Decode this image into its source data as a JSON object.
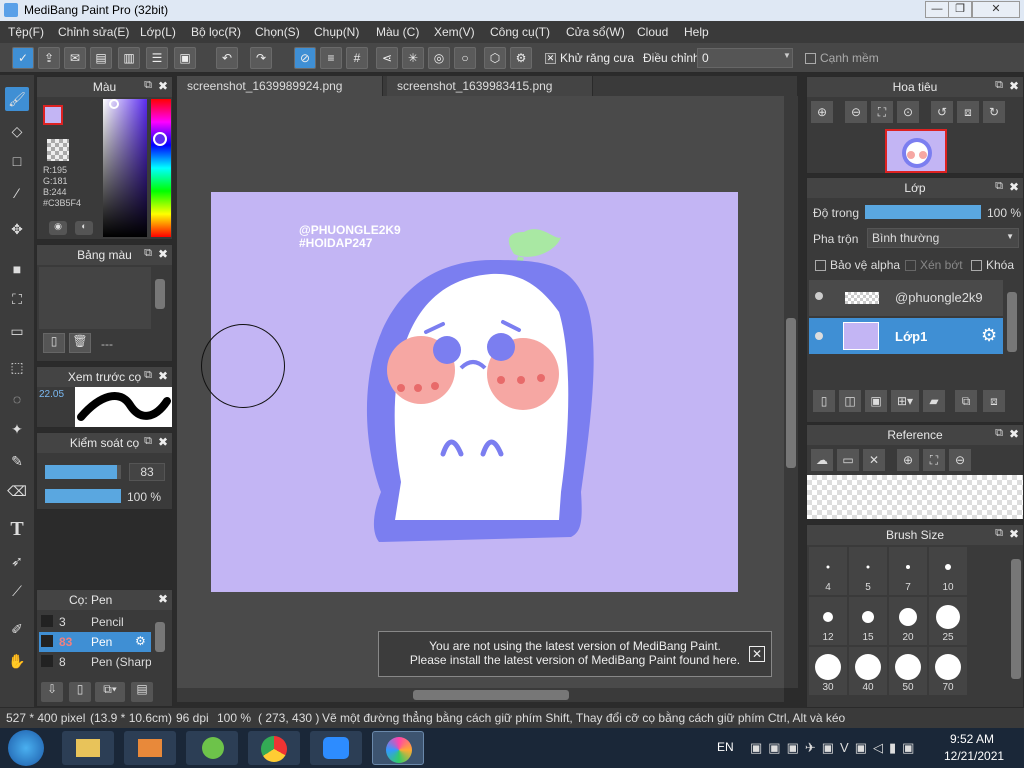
{
  "window": {
    "title": "MediBang Paint Pro (32bit)",
    "min": "—",
    "max": "❐",
    "close": "✕"
  },
  "menu": [
    "Tệp(F)",
    "Chỉnh sửa(E)",
    "Lớp(L)",
    "Bộ lọc(R)",
    "Chọn(S)",
    "Chụp(N)",
    "Màu (C)",
    "Xem(V)",
    "Công cụ(T)",
    "Cửa sổ(W)",
    "Cloud",
    "Help"
  ],
  "toolbar": {
    "antialias_label": "Khử răng cưa",
    "adjust_label": "Điều chỉnh",
    "adjust_value": "0",
    "soft_edge_label": "Cạnh mềm"
  },
  "tabs": [
    "screenshot_1639989924.png",
    "screenshot_1639983415.png"
  ],
  "color_panel": {
    "title": "Màu",
    "r": "R:195",
    "g": "G:181",
    "b": "B:244",
    "hex": "#C3B5F4",
    "color": "#c3b5f4"
  },
  "palette_panel": {
    "title": "Bảng màu",
    "value": "---"
  },
  "preview_panel": {
    "title": "Xem trước cọ",
    "size": "22.05"
  },
  "brush_control": {
    "title": "Kiểm soát cọ",
    "size": "83",
    "opacity": "100 %",
    "size_fraction": 0.95,
    "opacity_fraction": 1.0
  },
  "brush_list": {
    "title": "Cọ: Pen",
    "items": [
      {
        "num": "3",
        "name": "Pencil"
      },
      {
        "num": "83",
        "name": "Pen"
      },
      {
        "num": "8",
        "name": "Pen (Sharp)"
      }
    ]
  },
  "canvas": {
    "handle": "@PHUONGLE2K9",
    "tag": "#HOIDAP247",
    "bg": "#c3b5f4"
  },
  "navigator": {
    "title": "Hoa tiêu"
  },
  "layer_panel": {
    "title": "Lớp",
    "opacity_label": "Độ trong",
    "opacity_value": "100 %",
    "opacity_fraction": 1.0,
    "blend_label": "Pha trộn",
    "blend_value": "Bình thường",
    "alpha_label": "Bảo vệ alpha",
    "clip_label": "Xén bớt",
    "lock_label": "Khóa",
    "layers": [
      {
        "name": "@phuongle2k9"
      },
      {
        "name": "Lớp1"
      }
    ]
  },
  "reference": {
    "title": "Reference"
  },
  "brush_size": {
    "title": "Brush Size",
    "sizes": [
      "4",
      "5",
      "7",
      "10",
      "12",
      "15",
      "20",
      "25",
      "30",
      "40",
      "50",
      "70"
    ]
  },
  "notification": {
    "line1": "You are not using the latest version of MediBang Paint.",
    "line2": "Please install the latest version of MediBang Paint found here."
  },
  "status": {
    "dims": "527 * 400 pixel",
    "cm": "(13.9 * 10.6cm)",
    "dpi": "96 dpi",
    "zoom": "100 %",
    "coords": "( 273, 430 )",
    "hint": "Vẽ một đường thẳng bằng cách giữ phím Shift, Thay đổi cỡ cọ bằng cách giữ phím Ctrl, Alt và kéo"
  },
  "taskbar": {
    "lang": "EN",
    "time": "9:52 AM",
    "date": "12/21/2021"
  }
}
